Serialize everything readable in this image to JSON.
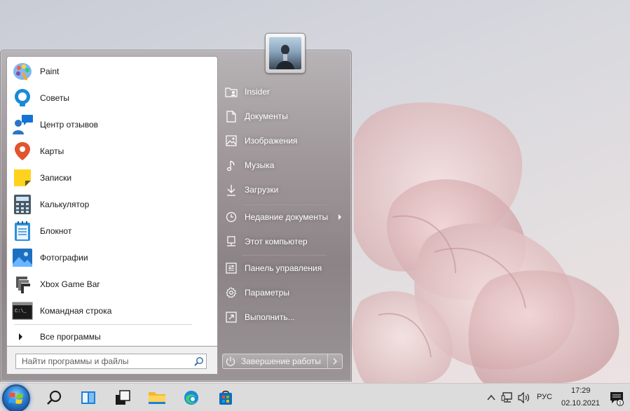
{
  "start_menu": {
    "programs": [
      {
        "label": "Paint",
        "icon": "paint-icon"
      },
      {
        "label": "Советы",
        "icon": "tips-icon"
      },
      {
        "label": "Центр отзывов",
        "icon": "feedback-hub-icon"
      },
      {
        "label": "Карты",
        "icon": "maps-icon"
      },
      {
        "label": "Записки",
        "icon": "sticky-notes-icon"
      },
      {
        "label": "Калькулятор",
        "icon": "calculator-icon"
      },
      {
        "label": "Блокнот",
        "icon": "notepad-icon"
      },
      {
        "label": "Фотографии",
        "icon": "photos-icon"
      },
      {
        "label": "Xbox Game Bar",
        "icon": "xbox-game-bar-icon"
      },
      {
        "label": "Командная строка",
        "icon": "command-prompt-icon"
      }
    ],
    "all_programs": "Все программы",
    "search": {
      "placeholder": "Найти программы и файлы",
      "value": ""
    },
    "right_items": [
      {
        "label": "Insider",
        "icon": "user-folder-icon"
      },
      {
        "label": "Документы",
        "icon": "document-icon"
      },
      {
        "label": "Изображения",
        "icon": "image-icon"
      },
      {
        "label": "Музыка",
        "icon": "music-icon"
      },
      {
        "label": "Загрузки",
        "icon": "download-icon"
      },
      {
        "label": "Недавние документы",
        "icon": "clock-icon"
      },
      {
        "label": "Этот компьютер",
        "icon": "computer-icon"
      },
      {
        "label": "Панель управления",
        "icon": "control-panel-icon"
      },
      {
        "label": "Параметры",
        "icon": "gear-icon"
      },
      {
        "label": "Выполнить...",
        "icon": "run-icon"
      }
    ],
    "shutdown_label": "Завершение работы"
  },
  "taskbar": {
    "buttons": [
      "start-orb",
      "search-icon",
      "task-view-icon",
      "widgets-icon",
      "file-explorer-icon",
      "edge-icon",
      "store-icon"
    ],
    "tray": {
      "language": "РУС",
      "time": "17:29",
      "date": "02.10.2021",
      "notification_count": "1"
    }
  },
  "colors": {
    "accent": "#0078d4",
    "menu_frame": "#9e9698",
    "taskbar": "#dcdcdc"
  }
}
